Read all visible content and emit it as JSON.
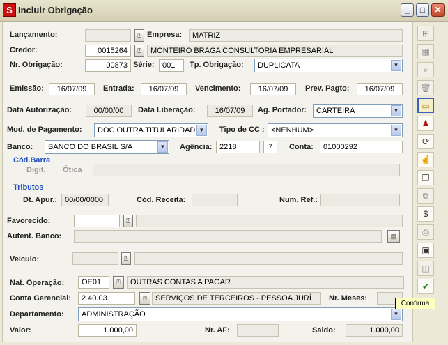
{
  "window": {
    "title": "Incluir Obrigação",
    "app_icon": "S"
  },
  "labels": {
    "lancamento": "Lançamento:",
    "empresa": "Empresa:",
    "credor": "Credor:",
    "nr_obrigacao": "Nr. Obrigação:",
    "serie": "Série:",
    "tp_obrigacao": "Tp. Obrigação:",
    "emissao": "Emissão:",
    "entrada": "Entrada:",
    "vencimento": "Vencimento:",
    "prev_pagto": "Prev. Pagto:",
    "data_autorizacao": "Data Autorização:",
    "data_liberacao": "Data Liberação:",
    "ag_portador": "Ag. Portador:",
    "mod_pagamento": "Mod. de Pagamento:",
    "tipo_cc": "Tipo de CC :",
    "banco": "Banco:",
    "agencia": "Agência:",
    "conta": "Conta:",
    "cod_barra": "Cód.Barra",
    "digit": "Digit.",
    "otica": "Ótica",
    "tributos": "Tributos",
    "dt_apur": "Dt. Apur.:",
    "cod_receita": "Cód. Receita:",
    "num_ref": "Num. Ref.:",
    "favorecido": "Favorecido:",
    "autent_banco": "Autent. Banco:",
    "veiculo": "Veículo:",
    "nat_operacao": "Nat. Operação:",
    "conta_gerencial": "Conta Gerencial:",
    "nr_meses": "Nr. Meses:",
    "departamento": "Departamento:",
    "valor": "Valor:",
    "nr_af": "Nr. AF:",
    "saldo": "Saldo:"
  },
  "values": {
    "lancamento": "",
    "empresa": "MATRIZ",
    "credor_code": "0015264",
    "credor_name": "MONTEIRO BRAGA CONSULTORIA EMPRESARIAL",
    "nr_obrigacao": "00873",
    "serie": "001",
    "tp_obrigacao": "DUPLICATA",
    "emissao": "16/07/09",
    "entrada": "16/07/09",
    "vencimento": "16/07/09",
    "prev_pagto": "16/07/09",
    "data_autorizacao": "00/00/00",
    "data_liberacao": "16/07/09",
    "ag_portador": "CARTEIRA",
    "mod_pagamento": "DOC OUTRA TITULARIDADE",
    "tipo_cc": "<NENHUM>",
    "banco": "BANCO DO BRASIL S/A",
    "agencia": "2218",
    "agencia_dv": "7",
    "conta": "01000292",
    "dt_apur": "00/00/0000",
    "nat_operacao_code": "OE01",
    "nat_operacao_name": "OUTRAS CONTAS A PAGAR",
    "conta_gerencial_code": "2.40.03.",
    "conta_gerencial_name": "SERVIÇOS DE TERCEIROS - PESSOA JURÍ",
    "departamento": "ADMINISTRAÇÃO",
    "valor": "1.000,00",
    "saldo": "1.000,00"
  },
  "toolbar": {
    "tooltip": "Confirma"
  },
  "icons": {
    "lookup": "⍰",
    "dropdown": "▼",
    "minimize": "_",
    "maximize": "□",
    "close": "✕"
  }
}
